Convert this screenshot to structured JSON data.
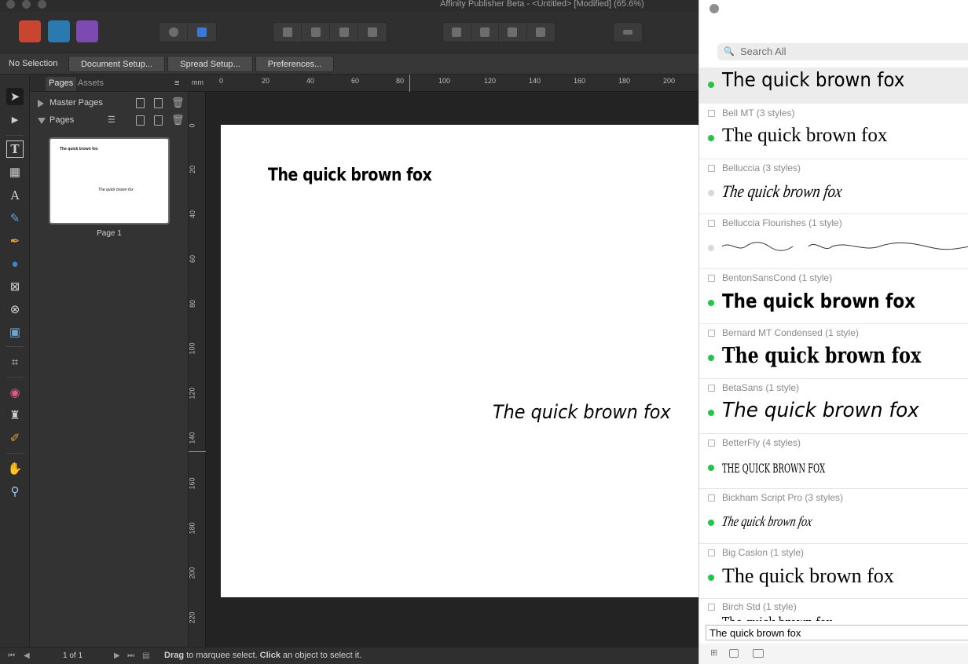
{
  "window": {
    "title": "Affinity Publisher Beta - <Untitled> [Modified] (65.6%)"
  },
  "personas": [
    "publisher-persona-icon",
    "designer-persona-icon",
    "photo-persona-icon"
  ],
  "context": {
    "selection": "No Selection",
    "buttons": [
      "Document Setup...",
      "Spread Setup...",
      "Preferences..."
    ]
  },
  "pages_panel": {
    "tabs": [
      "Pages",
      "Assets"
    ],
    "master_pages": "Master Pages",
    "pages": "Pages",
    "thumb_line1": "The quick brown fox",
    "thumb_line2": "The quick brown fox",
    "page_label": "Page 1"
  },
  "ruler": {
    "unit": "mm",
    "h_labels": [
      "0",
      "20",
      "40",
      "60",
      "80",
      "100",
      "120",
      "140",
      "160",
      "180",
      "200"
    ],
    "v_labels": [
      "0",
      "20",
      "40",
      "60",
      "80",
      "100",
      "120",
      "140",
      "160",
      "180",
      "200",
      "220"
    ]
  },
  "canvas": {
    "heading": "The quick brown fox",
    "italic": "The quick brown fox"
  },
  "status": {
    "page_count": "1 of 1",
    "hint_drag": "Drag",
    "hint_mid": " to marquee select. ",
    "hint_click": "Click",
    "hint_end": " an object to select it."
  },
  "font_panel": {
    "search_placeholder": "Search All",
    "sample_text": "The quick brown fox",
    "fonts": [
      {
        "header": "",
        "sample": "The quick brown fox",
        "active": true
      },
      {
        "header": "Bell MT (3 styles)",
        "sample": "The quick brown fox",
        "active": true
      },
      {
        "header": "Belluccia (3 styles)",
        "sample": "The quick brown fox",
        "active": false
      },
      {
        "header": "Belluccia Flourishes (1 style)",
        "sample": "",
        "active": false
      },
      {
        "header": "BentonSansCond (1 style)",
        "sample": "The quick brown fox",
        "active": true
      },
      {
        "header": "Bernard MT Condensed (1 style)",
        "sample": "The quick brown fox",
        "active": true
      },
      {
        "header": "BetaSans (1 style)",
        "sample": "The quick brown fox",
        "active": true
      },
      {
        "header": "BetterFly (4 styles)",
        "sample": "THE QUICK BROWN FOX",
        "active": true
      },
      {
        "header": "Bickham Script Pro (3 styles)",
        "sample": "The quick brown fox",
        "active": true
      },
      {
        "header": "Big Caslon (1 style)",
        "sample": "The quick brown fox",
        "active": true
      },
      {
        "header": "Birch Std (1 style)",
        "sample": "The quick brown fox",
        "active": true
      }
    ]
  }
}
